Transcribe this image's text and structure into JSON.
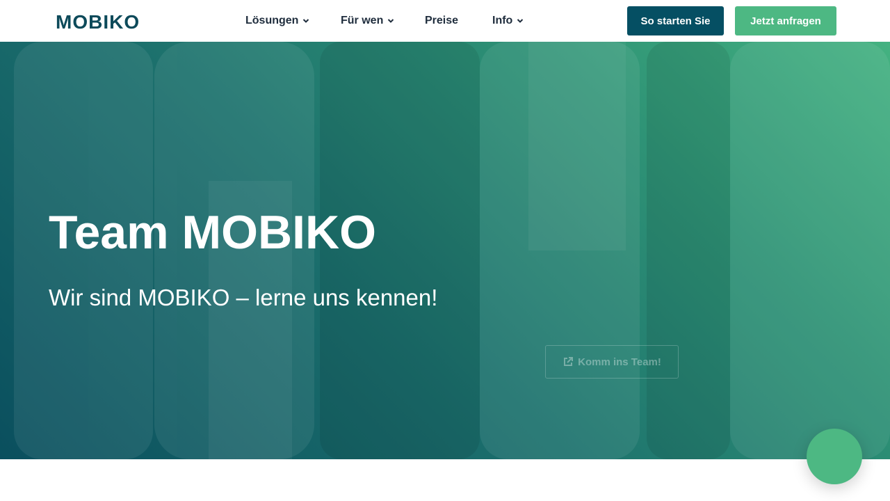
{
  "brand": {
    "logo_text": "MOBIKO",
    "primary_color": "#054f63",
    "accent_color": "#4db883"
  },
  "nav": {
    "items": [
      {
        "label": "Lösungen",
        "has_dropdown": true,
        "icon": "chevron-down-icon"
      },
      {
        "label": "Für wen",
        "has_dropdown": true,
        "icon": "chevron-down-icon"
      },
      {
        "label": "Preise",
        "has_dropdown": false
      },
      {
        "label": "Info",
        "has_dropdown": true,
        "icon": "chevron-down-icon"
      }
    ],
    "cta_primary": "So starten Sie",
    "cta_secondary": "Jetzt anfragen"
  },
  "hero": {
    "title": "Team MOBIKO",
    "subtitle": "Wir sind MOBIKO – lerne uns kennen!",
    "join_button": {
      "label": "Komm ins Team!",
      "icon": "external-link-icon"
    }
  },
  "chat": {
    "icon": "chat-bubble-icon"
  }
}
